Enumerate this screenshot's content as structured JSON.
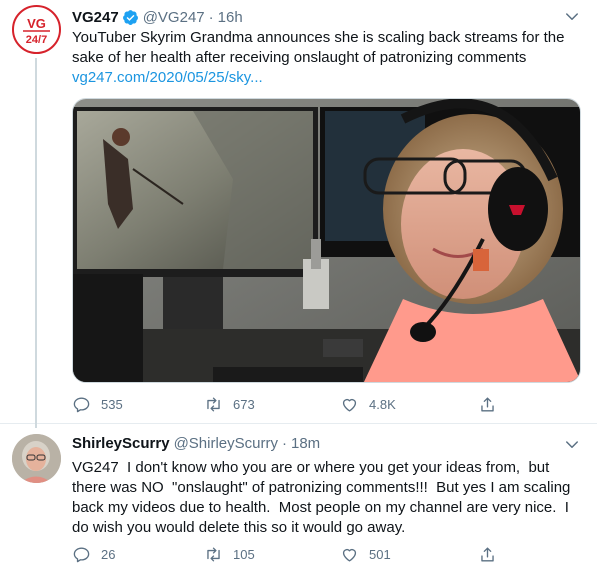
{
  "tweet1": {
    "author_name": "VG247",
    "author_handle": "@VG247",
    "separator": "·",
    "time": "16h",
    "text": "YouTuber Skyrim Grandma announces she is scaling back streams for the sake of her health after receiving onslaught of patronizing comments",
    "link": "vg247.com/2020/05/25/sky...",
    "avatar_text_top": "VG",
    "avatar_text_bottom": "24/7",
    "replies": "535",
    "retweets": "673",
    "likes": "4.8K",
    "verified": true
  },
  "tweet2": {
    "author_name": "ShirleyScurry",
    "author_handle": "@ShirleyScurry",
    "separator": "·",
    "time": "18m",
    "text": "VG247  I don't know who you are or where you get your ideas from,  but there was NO  \"onslaught\" of patronizing comments!!!  But yes I am scaling back my videos due to health.  Most people on my channel are very nice.  I do wish you would delete this so it would go away.",
    "replies": "26",
    "retweets": "105",
    "likes": "501"
  },
  "icons": {
    "reply": "reply-icon",
    "retweet": "retweet-icon",
    "like": "heart-icon",
    "share": "share-icon",
    "more": "chevron-down-icon",
    "verified": "verified-badge-icon"
  },
  "colors": {
    "brand_red": "#d6222b",
    "link_blue": "#1b95e0",
    "verified_blue": "#1da1f2",
    "muted": "#5b7083"
  }
}
